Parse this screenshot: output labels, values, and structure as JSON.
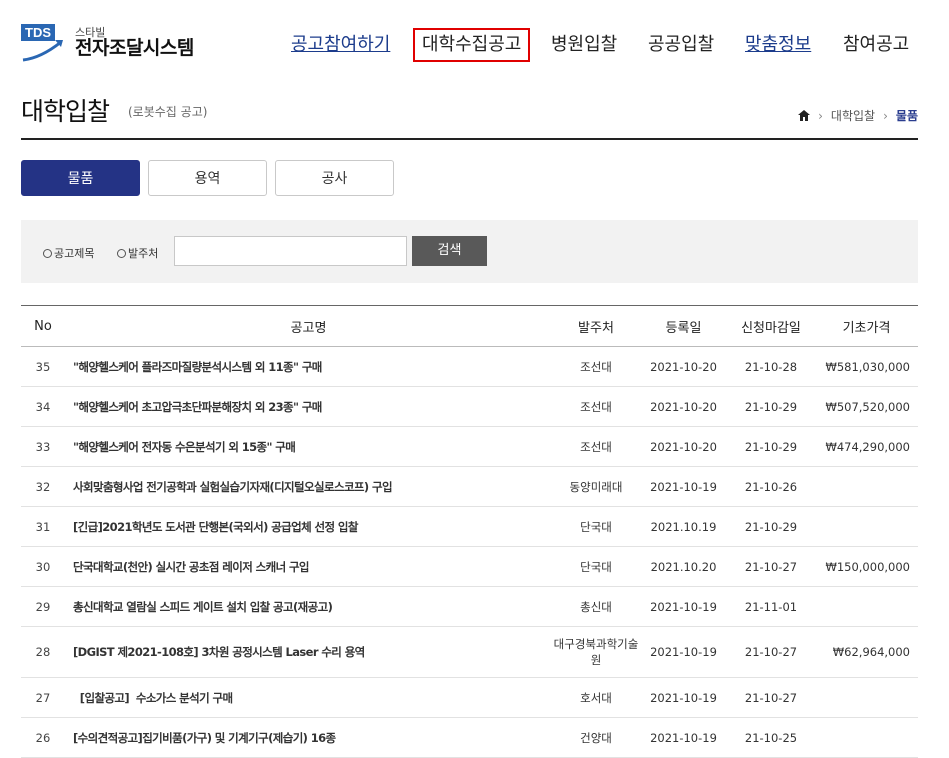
{
  "logo": {
    "badge": "TDS",
    "sub": "스타빌",
    "main": "전자조달시스템"
  },
  "nav": [
    {
      "label": "공고참여하기"
    },
    {
      "label": "대학수집공고"
    },
    {
      "label": "병원입찰"
    },
    {
      "label": "공공입찰"
    },
    {
      "label": "맞춤정보"
    },
    {
      "label": "참여공고"
    }
  ],
  "page": {
    "title": "대학입찰",
    "subtitle": "(로봇수집 공고)"
  },
  "breadcrumb": {
    "level1": "대학입찰",
    "current": "물품",
    "separator": "›"
  },
  "tabs": [
    {
      "label": "물품"
    },
    {
      "label": "용역"
    },
    {
      "label": "공사"
    }
  ],
  "search": {
    "radio1": "공고제목",
    "radio2": "발주처",
    "input_value": "",
    "button_label": "검색"
  },
  "table": {
    "headers": {
      "no": "No",
      "title": "공고명",
      "org": "발주처",
      "reg": "등록일",
      "deadline": "신청마감일",
      "price": "기초가격"
    },
    "rows": [
      {
        "no": "35",
        "title": "\"해양헬스케어 플라즈마질량분석시스템 외 11종\" 구매",
        "org": "조선대",
        "reg": "2021-10-20",
        "deadline": "21-10-28",
        "price": "₩581,030,000"
      },
      {
        "no": "34",
        "title": "\"해양헬스케어 초고압극초단파분해장치 외 23종\" 구매",
        "org": "조선대",
        "reg": "2021-10-20",
        "deadline": "21-10-29",
        "price": "₩507,520,000"
      },
      {
        "no": "33",
        "title": "\"해양헬스케어 전자동 수은분석기 외 15종\" 구매",
        "org": "조선대",
        "reg": "2021-10-20",
        "deadline": "21-10-29",
        "price": "₩474,290,000"
      },
      {
        "no": "32",
        "title": "사회맞춤형사업 전기공학과 실험실습기자재(디지털오실로스코프) 구입",
        "org": "동양미래대",
        "reg": "2021-10-19",
        "deadline": "21-10-26",
        "price": ""
      },
      {
        "no": "31",
        "title": "[긴급]2021학년도 도서관 단행본(국외서) 공급업체 선정 입찰",
        "org": "단국대",
        "reg": "2021.10.19",
        "deadline": "21-10-29",
        "price": ""
      },
      {
        "no": "30",
        "title": "단국대학교(천안) 실시간 공초점 레이저 스캐너 구입",
        "org": "단국대",
        "reg": "2021.10.20",
        "deadline": "21-10-27",
        "price": "₩150,000,000"
      },
      {
        "no": "29",
        "title": "총신대학교 열람실 스피드 게이트 설치 입찰 공고(재공고)",
        "org": "총신대",
        "reg": "2021-10-19",
        "deadline": "21-11-01",
        "price": ""
      },
      {
        "no": "28",
        "title": "[DGIST 제2021-108호] 3차원 공정시스템 Laser 수리 용역",
        "org": "대구경북과학기술원",
        "reg": "2021-10-19",
        "deadline": "21-10-27",
        "price": "₩62,964,000"
      },
      {
        "no": "27",
        "title": "  [입찰공고]  수소가스 분석기 구매",
        "org": "호서대",
        "reg": "2021-10-19",
        "deadline": "21-10-27",
        "price": ""
      },
      {
        "no": "26",
        "title": "[수의견적공고]집기비품(가구) 및 기계기구(제습기) 16종",
        "org": "건양대",
        "reg": "2021-10-19",
        "deadline": "21-10-25",
        "price": ""
      }
    ]
  }
}
